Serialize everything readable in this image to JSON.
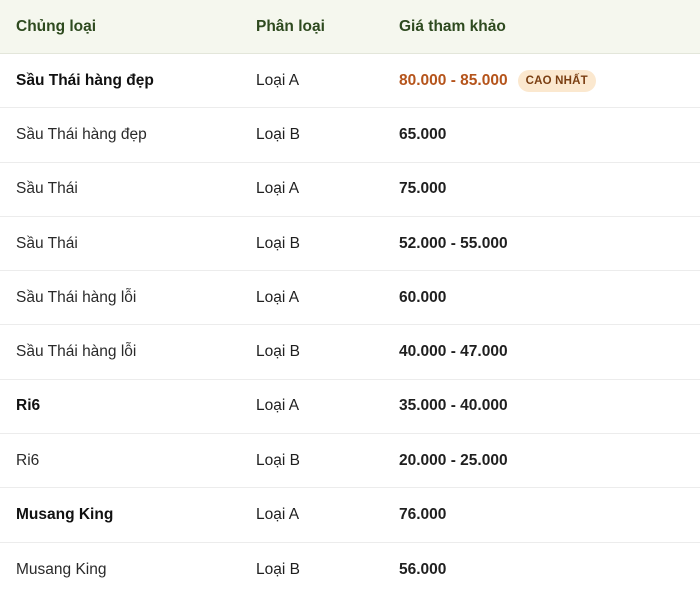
{
  "header": {
    "col_type": "Chủng loại",
    "col_class": "Phân loại",
    "col_price": "Giá tham khảo"
  },
  "rows": [
    {
      "name": "Sầu Thái hàng đẹp",
      "class": "Loại A",
      "price": "80.000 - 85.000",
      "badge": "CAO NHẤT"
    },
    {
      "name": "Sầu Thái hàng đẹp",
      "class": "Loại B",
      "price": "65.000"
    },
    {
      "name": "Sầu Thái",
      "class": "Loại A",
      "price": "75.000"
    },
    {
      "name": "Sầu Thái",
      "class": "Loại B",
      "price": "52.000 - 55.000"
    },
    {
      "name": "Sầu Thái hàng lỗi",
      "class": "Loại A",
      "price": "60.000"
    },
    {
      "name": "Sầu Thái hàng lỗi",
      "class": "Loại B",
      "price": "40.000 - 47.000"
    },
    {
      "name": "Ri6",
      "class": "Loại A",
      "price": "35.000 - 40.000"
    },
    {
      "name": "Ri6",
      "class": "Loại B",
      "price": "20.000 - 25.000"
    },
    {
      "name": "Musang King",
      "class": "Loại A",
      "price": "76.000"
    },
    {
      "name": "Musang King",
      "class": "Loại B",
      "price": "56.000"
    }
  ],
  "colors": {
    "header_bg": "#f5f7ee",
    "header_text": "#2e4a1f",
    "highlight_price": "#b5541b",
    "badge_bg": "#fbe8cf",
    "badge_text": "#7a3e12"
  }
}
